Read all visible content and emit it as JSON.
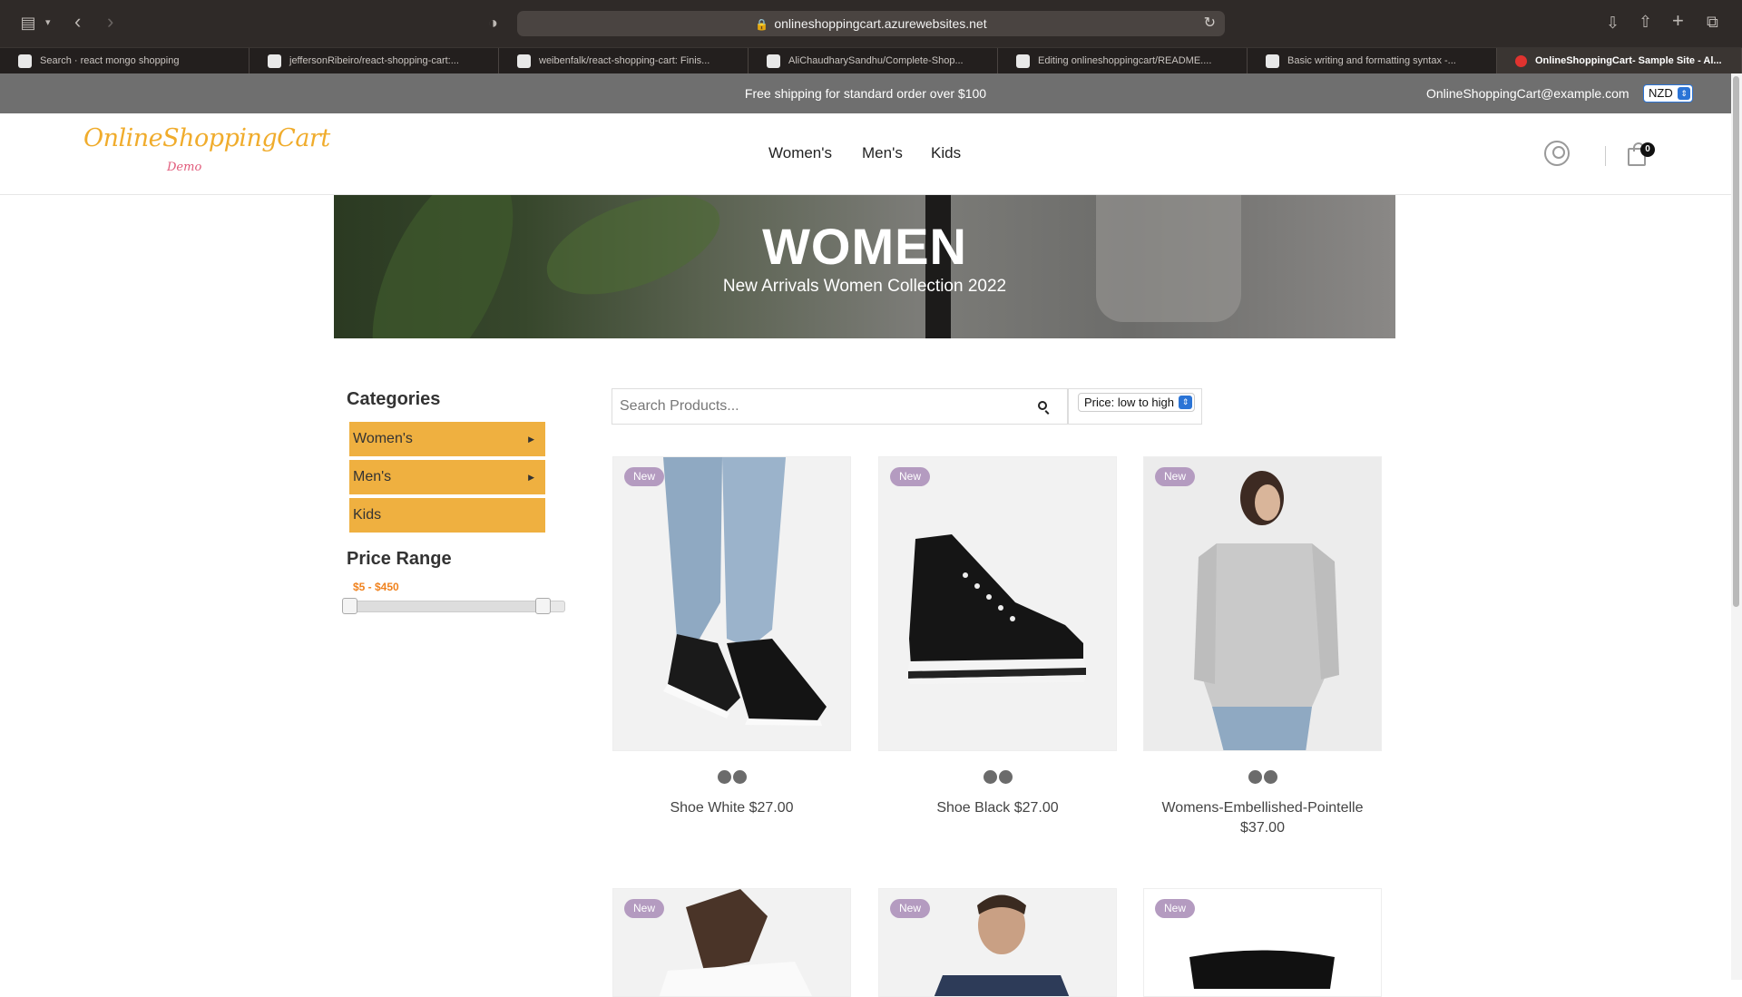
{
  "browser": {
    "url": "onlineshoppingcart.azurewebsites.net",
    "tabs": [
      {
        "label": "Search · react mongo shopping"
      },
      {
        "label": "jeffersonRibeiro/react-shopping-cart:..."
      },
      {
        "label": "weibenfalk/react-shopping-cart: Finis..."
      },
      {
        "label": "AliChaudharySandhu/Complete-Shop..."
      },
      {
        "label": "Editing onlineshoppingcart/README...."
      },
      {
        "label": "Basic writing and formatting syntax -..."
      },
      {
        "label": "OnlineShoppingCart- Sample Site - Al..."
      }
    ]
  },
  "announcement": {
    "message": "Free shipping for standard order over $100",
    "email": "OnlineShoppingCart@example.com",
    "currency": "NZD"
  },
  "header": {
    "logo": "OnlineShoppingCart",
    "logo_sub": "Demo",
    "nav": [
      "Women's",
      "Men's",
      "Kids"
    ],
    "cart_count": "0"
  },
  "hero": {
    "title": "WOMEN",
    "subtitle": "New Arrivals Women Collection 2022"
  },
  "sidebar": {
    "categories_title": "Categories",
    "categories": [
      {
        "label": "Women's",
        "caret": "▶"
      },
      {
        "label": "Men's",
        "caret": "▶"
      },
      {
        "label": "Kids",
        "caret": ""
      }
    ],
    "price_title": "Price Range",
    "price_value": "$5 - $450",
    "price_min": 5,
    "price_max": 450
  },
  "search": {
    "placeholder": "Search Products...",
    "sort_selected": "Price: low to high"
  },
  "products": [
    {
      "title": "Shoe White $27.00",
      "badge": "New",
      "image": "sneakers-on-feet"
    },
    {
      "title": "Shoe Black $27.00",
      "badge": "New",
      "image": "black-high-top-sneaker"
    },
    {
      "title": "Womens-Embellished-Pointelle $37.00",
      "badge": "New",
      "image": "grey-knit-cardigan"
    },
    {
      "title": "",
      "badge": "New",
      "image": "woman-white-top"
    },
    {
      "title": "",
      "badge": "New",
      "image": "man-navy-shirt"
    },
    {
      "title": "",
      "badge": "New",
      "image": "black-sunglasses"
    }
  ],
  "colors": {
    "accent": "#efb040",
    "price_range": "#f0821e",
    "badge": "#b49bc0",
    "logo": "#f0ac2c"
  }
}
